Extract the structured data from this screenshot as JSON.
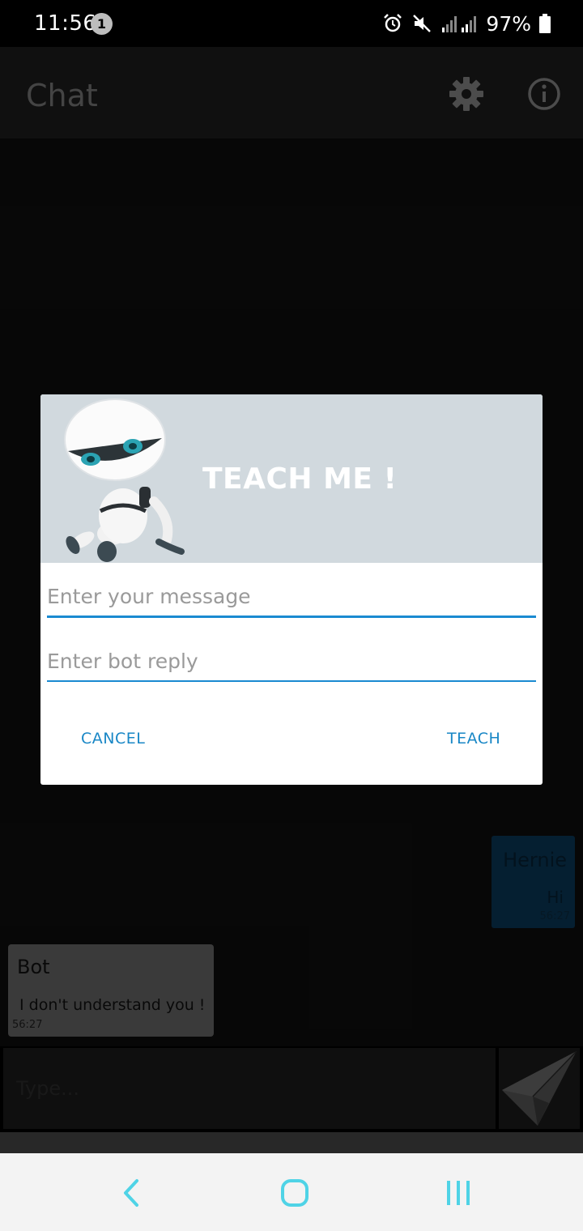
{
  "status_bar": {
    "time": "11:56",
    "notification_count": "1",
    "battery_percent": "97%"
  },
  "app_bar": {
    "title": "Chat",
    "settings_icon": "gear-icon",
    "info_icon": "info-icon"
  },
  "messages": [
    {
      "sender": "Hernie",
      "text": "Hi",
      "time": "56:27",
      "side": "right",
      "color": "#0a3a5a"
    },
    {
      "sender": "Bot",
      "text": "I don't understand you !",
      "time": "56:27",
      "side": "left",
      "color": "#6b6b6b"
    }
  ],
  "composer": {
    "placeholder": "Type...",
    "send_icon": "paper-plane-icon"
  },
  "dialog": {
    "title": "TEACH ME !",
    "message_placeholder": "Enter your message",
    "reply_placeholder": "Enter bot reply",
    "cancel_label": "CANCEL",
    "teach_label": "TEACH",
    "accent_color": "#1a8ad1",
    "header_color": "#d1d9de"
  },
  "nav_bar": {
    "back_icon": "back-chevron-icon",
    "home_icon": "home-icon",
    "recents_icon": "recents-icon"
  }
}
